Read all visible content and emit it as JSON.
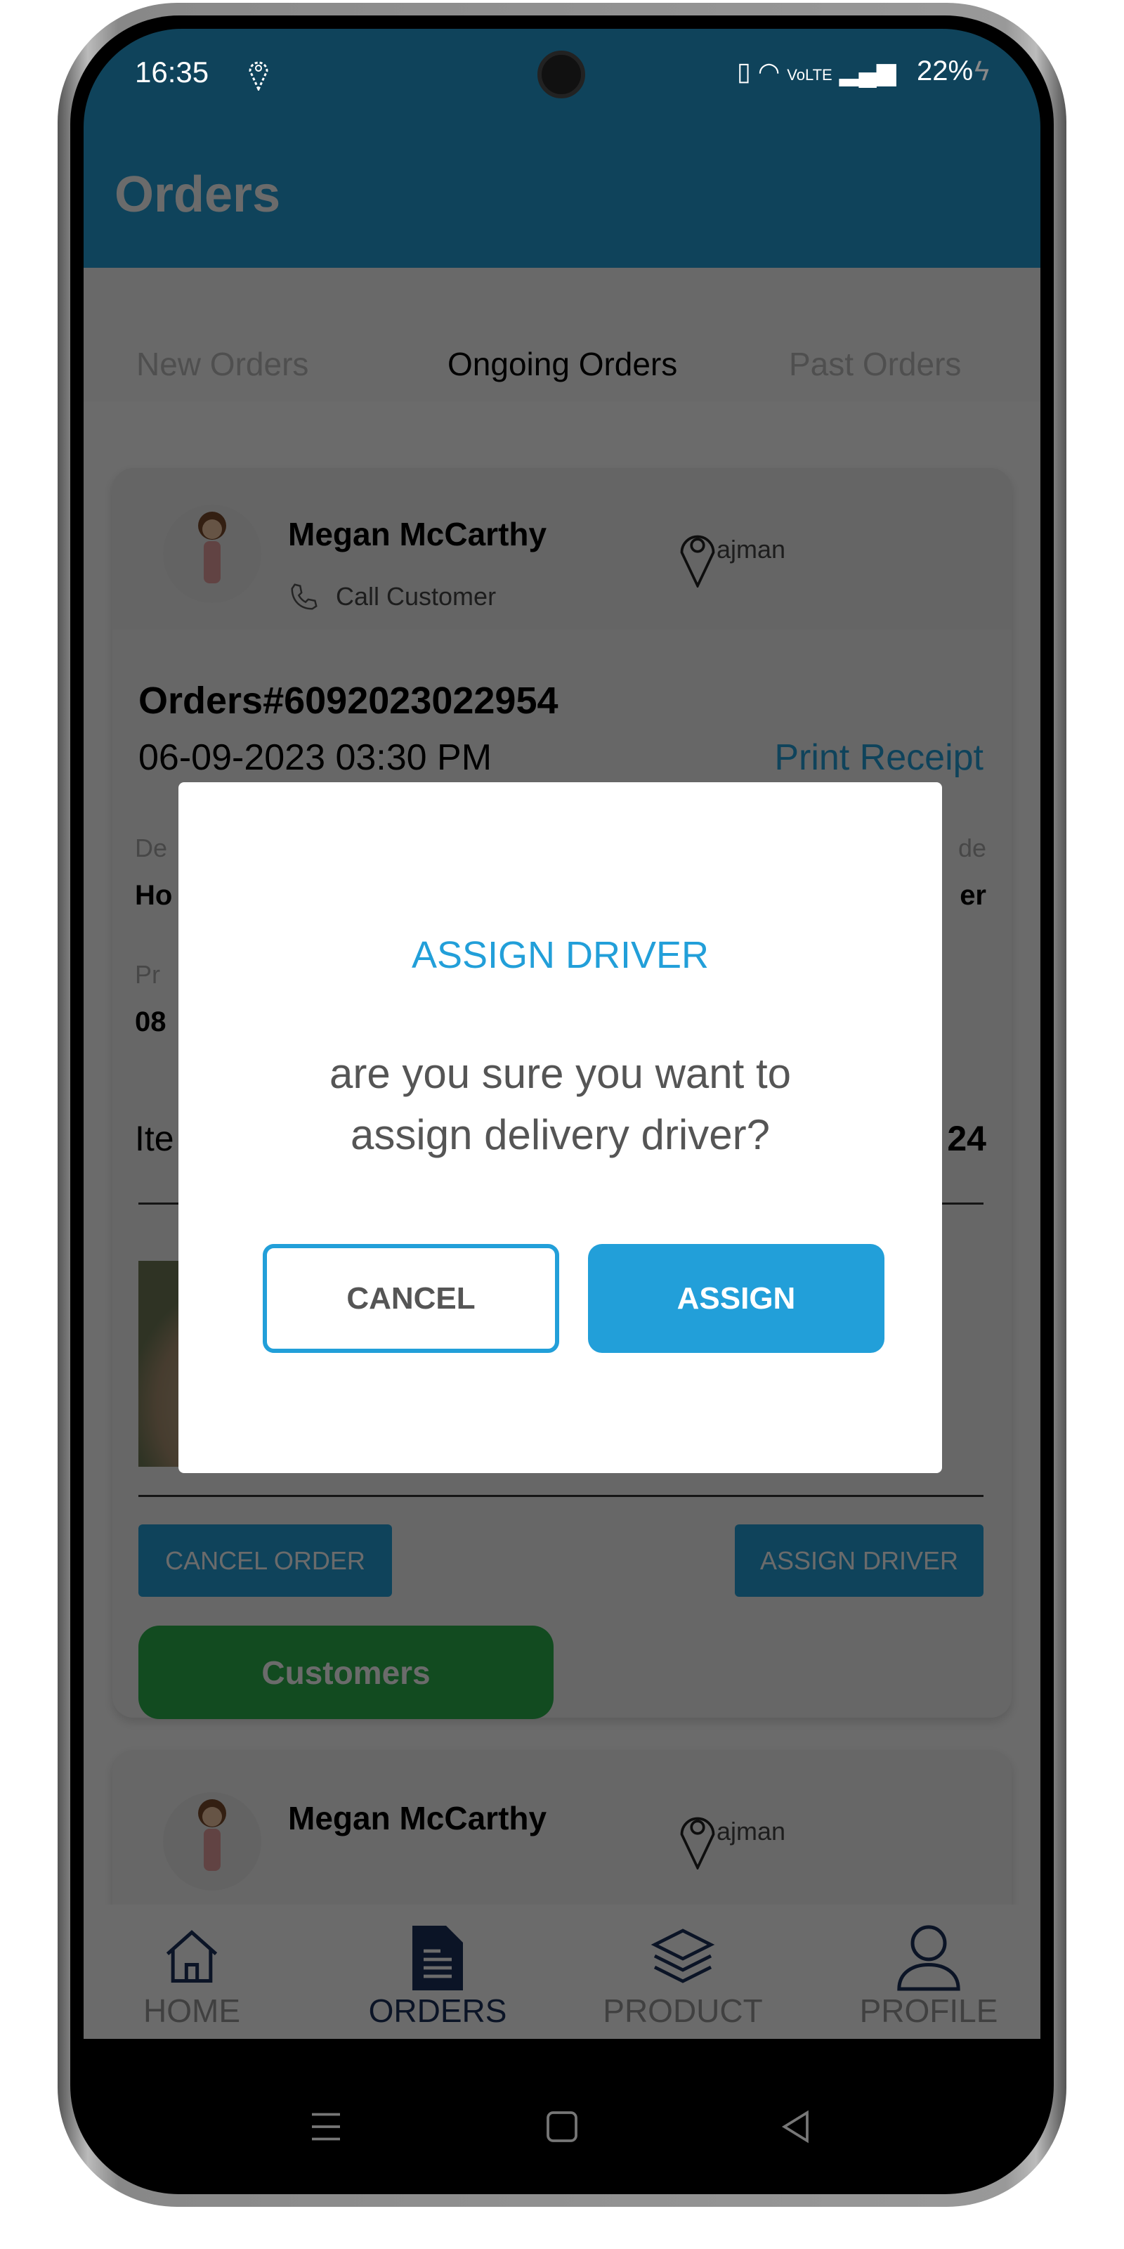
{
  "status_bar": {
    "time": "16:35",
    "battery": "22%"
  },
  "app_bar": {
    "title": "Orders"
  },
  "tabs": [
    {
      "label": "New Orders"
    },
    {
      "label": "Ongoing Orders",
      "active": true
    },
    {
      "label": "Past Orders"
    }
  ],
  "orders": [
    {
      "customer": "Megan  McCarthy",
      "call_label": "Call Customer",
      "location": "ajman",
      "order_number": "Orders#6092023022954",
      "date_fragment": "06-09-2023 03:30 PM",
      "print_fragment": "Print Receipt",
      "left_label_1": "De",
      "left_value_1": "Ho",
      "right_label_1": "de",
      "right_value_1": "er",
      "left_label_2": "Pr",
      "left_value_2": "08",
      "items_fragment": "Ite",
      "total_fragment": "24",
      "cancel_label": "CANCEL ORDER",
      "assign_label": "ASSIGN DRIVER",
      "customers_label": "Customers"
    },
    {
      "customer": "Megan  McCarthy",
      "location": "ajman"
    }
  ],
  "dialog": {
    "title": "ASSIGN DRIVER",
    "message_line1": "are you sure you want to",
    "message_line2": "assign delivery driver?",
    "cancel_label": "CANCEL",
    "confirm_label": "ASSIGN"
  },
  "bottom_nav": [
    {
      "label": "HOME",
      "icon": "home-icon"
    },
    {
      "label": "ORDERS",
      "icon": "document-icon",
      "active": true
    },
    {
      "label": "PRODUCT",
      "icon": "layers-icon"
    },
    {
      "label": "PROFILE",
      "icon": "user-icon"
    }
  ],
  "colors": {
    "primary": "#24a0d8",
    "success": "#2bb24c",
    "active_nav": "#1a2f5a"
  }
}
